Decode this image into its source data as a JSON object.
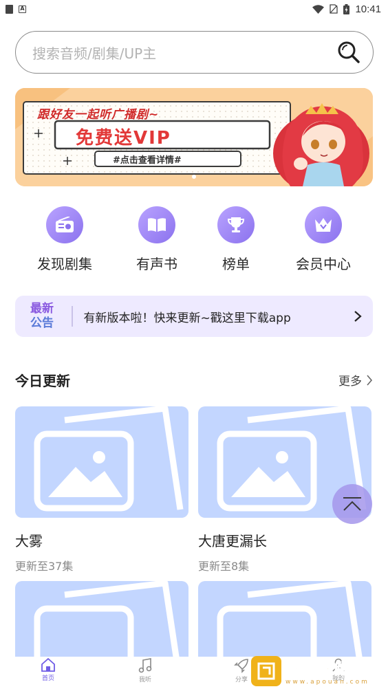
{
  "status_bar": {
    "time": "10:41"
  },
  "search": {
    "placeholder": "搜索音频/剧集/UP主"
  },
  "banner": {
    "headline": "跟好友一起听广播剧~",
    "title": "免费送VIP",
    "button": "#点击查看详情#",
    "page_indicator": {
      "count": 1,
      "active": 0
    }
  },
  "categories": [
    {
      "label": "发现剧集",
      "icon": "radio-icon"
    },
    {
      "label": "有声书",
      "icon": "book-icon"
    },
    {
      "label": "榜单",
      "icon": "trophy-icon"
    },
    {
      "label": "会员中心",
      "icon": "crown-icon"
    }
  ],
  "notice": {
    "tag_line1": "最新",
    "tag_line2": "公告",
    "message": "有新版本啦！快来更新~戳这里下载app"
  },
  "today_updates": {
    "title": "今日更新",
    "more_label": "更多",
    "items": [
      {
        "name": "大雾",
        "sub": "更新至37集"
      },
      {
        "name": "大唐更漏长",
        "sub": "更新至8集"
      }
    ]
  },
  "tab_bar": {
    "tabs": [
      {
        "label": "首页",
        "icon": "home-icon",
        "active": true
      },
      {
        "label": "我听",
        "icon": "music-note-icon",
        "active": false
      },
      {
        "label": "分享",
        "icon": "rocket-icon",
        "active": false
      },
      {
        "label": "我的",
        "icon": "user-icon",
        "active": false
      }
    ]
  },
  "watermark": {
    "text": "欧全软件园",
    "url": "www.apouan.com"
  },
  "colors": {
    "accent": "#7b66e6",
    "placeholder_blue": "#c3d6ff",
    "notice_bg": "#eeeaff"
  }
}
